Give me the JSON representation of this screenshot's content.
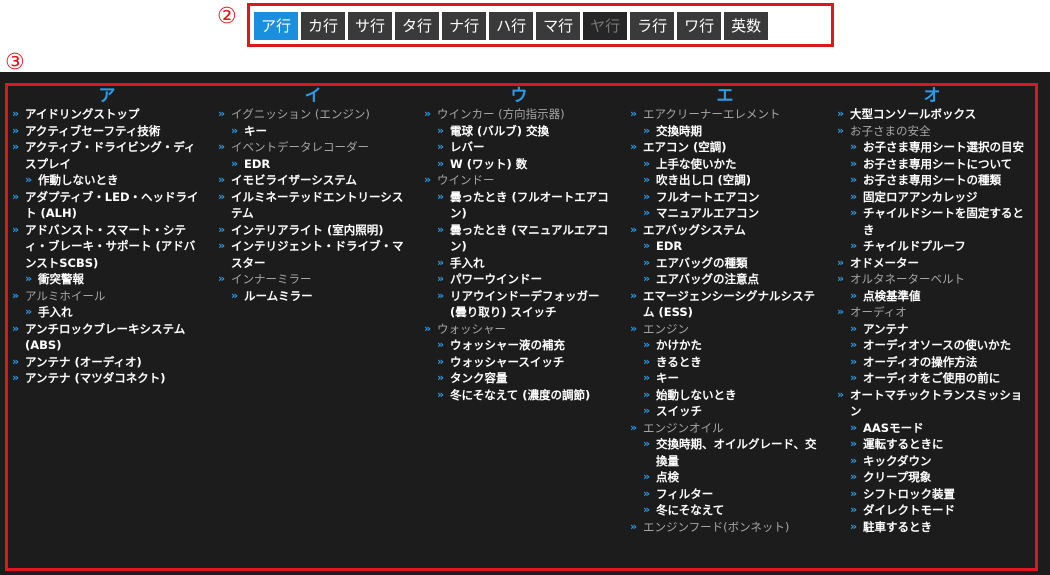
{
  "markers": {
    "tabs": "②",
    "list": "③"
  },
  "tabs": [
    {
      "label": "ア行",
      "state": "active"
    },
    {
      "label": "カ行",
      "state": "normal"
    },
    {
      "label": "サ行",
      "state": "normal"
    },
    {
      "label": "タ行",
      "state": "normal"
    },
    {
      "label": "ナ行",
      "state": "normal"
    },
    {
      "label": "ハ行",
      "state": "normal"
    },
    {
      "label": "マ行",
      "state": "normal"
    },
    {
      "label": "ヤ行",
      "state": "disabled"
    },
    {
      "label": "ラ行",
      "state": "normal"
    },
    {
      "label": "ワ行",
      "state": "normal"
    },
    {
      "label": "英数",
      "state": "normal"
    }
  ],
  "colors": {
    "accent": "#2a9be8",
    "active_tab": "#1a8fdd",
    "frame": "#e0161c",
    "bg": "#1c1c1c"
  },
  "columns": [
    {
      "heading": "ア",
      "items": [
        {
          "text": "アイドリングストップ",
          "level": 0,
          "style": "link"
        },
        {
          "text": "アクティブセーフティ技術",
          "level": 0,
          "style": "link"
        },
        {
          "text": "アクティブ・ドライビング・ディスプレイ",
          "level": 0,
          "style": "link"
        },
        {
          "text": "作動しないとき",
          "level": 1,
          "style": "link"
        },
        {
          "text": "アダプティブ・LED・ヘッドライト (ALH)",
          "level": 0,
          "style": "link"
        },
        {
          "text": "アドバンスト・スマート・シティ・ブレーキ・サポート (アドバンストSCBS)",
          "level": 0,
          "style": "link"
        },
        {
          "text": "衝突警報",
          "level": 1,
          "style": "link"
        },
        {
          "text": "アルミホイール",
          "level": 0,
          "style": "cat"
        },
        {
          "text": "手入れ",
          "level": 1,
          "style": "link"
        },
        {
          "text": "アンチロックブレーキシステム (ABS)",
          "level": 0,
          "style": "link"
        },
        {
          "text": "アンテナ (オーディオ)",
          "level": 0,
          "style": "link"
        },
        {
          "text": "アンテナ (マツダコネクト)",
          "level": 0,
          "style": "link"
        }
      ]
    },
    {
      "heading": "イ",
      "items": [
        {
          "text": "イグニッション (エンジン)",
          "level": 0,
          "style": "cat"
        },
        {
          "text": "キー",
          "level": 1,
          "style": "link"
        },
        {
          "text": "イベントデータレコーダー",
          "level": 0,
          "style": "cat"
        },
        {
          "text": "EDR",
          "level": 1,
          "style": "link"
        },
        {
          "text": "イモビライザーシステム",
          "level": 0,
          "style": "link"
        },
        {
          "text": "イルミネーテッドエントリーシステム",
          "level": 0,
          "style": "link"
        },
        {
          "text": "インテリアライト (室内照明)",
          "level": 0,
          "style": "link"
        },
        {
          "text": "インテリジェント・ドライブ・マスター",
          "level": 0,
          "style": "link"
        },
        {
          "text": "インナーミラー",
          "level": 0,
          "style": "cat"
        },
        {
          "text": "ルームミラー",
          "level": 1,
          "style": "link"
        }
      ]
    },
    {
      "heading": "ウ",
      "items": [
        {
          "text": "ウインカー (方向指示器)",
          "level": 0,
          "style": "cat"
        },
        {
          "text": "電球 (バルブ) 交換",
          "level": 1,
          "style": "link"
        },
        {
          "text": "レバー",
          "level": 1,
          "style": "link"
        },
        {
          "text": "W (ワット) 数",
          "level": 1,
          "style": "link"
        },
        {
          "text": "ウインドー",
          "level": 0,
          "style": "cat"
        },
        {
          "text": "曇ったとき (フルオートエアコン)",
          "level": 1,
          "style": "link"
        },
        {
          "text": "曇ったとき (マニュアルエアコン)",
          "level": 1,
          "style": "link"
        },
        {
          "text": "手入れ",
          "level": 1,
          "style": "link"
        },
        {
          "text": "パワーウインドー",
          "level": 1,
          "style": "link"
        },
        {
          "text": "リアウインドーデフォッガー (曇り取り) スイッチ",
          "level": 1,
          "style": "link"
        },
        {
          "text": "ウォッシャー",
          "level": 0,
          "style": "cat"
        },
        {
          "text": "ウォッシャー液の補充",
          "level": 1,
          "style": "link"
        },
        {
          "text": "ウォッシャースイッチ",
          "level": 1,
          "style": "link"
        },
        {
          "text": "タンク容量",
          "level": 1,
          "style": "link"
        },
        {
          "text": "冬にそなえて (濃度の調節)",
          "level": 1,
          "style": "link"
        }
      ]
    },
    {
      "heading": "エ",
      "items": [
        {
          "text": "エアクリーナーエレメント",
          "level": 0,
          "style": "cat"
        },
        {
          "text": "交換時期",
          "level": 1,
          "style": "link"
        },
        {
          "text": "エアコン (空調)",
          "level": 0,
          "style": "link"
        },
        {
          "text": "上手な使いかた",
          "level": 1,
          "style": "link"
        },
        {
          "text": "吹き出し口 (空調)",
          "level": 1,
          "style": "link"
        },
        {
          "text": "フルオートエアコン",
          "level": 1,
          "style": "link"
        },
        {
          "text": "マニュアルエアコン",
          "level": 1,
          "style": "link"
        },
        {
          "text": "エアバッグシステム",
          "level": 0,
          "style": "link"
        },
        {
          "text": "EDR",
          "level": 1,
          "style": "link"
        },
        {
          "text": "エアバッグの種類",
          "level": 1,
          "style": "link"
        },
        {
          "text": "エアバッグの注意点",
          "level": 1,
          "style": "link"
        },
        {
          "text": "エマージェンシーシグナルシステム (ESS)",
          "level": 0,
          "style": "link"
        },
        {
          "text": "エンジン",
          "level": 0,
          "style": "cat"
        },
        {
          "text": "かけかた",
          "level": 1,
          "style": "link"
        },
        {
          "text": "きるとき",
          "level": 1,
          "style": "link"
        },
        {
          "text": "キー",
          "level": 1,
          "style": "link"
        },
        {
          "text": "始動しないとき",
          "level": 1,
          "style": "link"
        },
        {
          "text": "スイッチ",
          "level": 1,
          "style": "link"
        },
        {
          "text": "エンジンオイル",
          "level": 0,
          "style": "cat"
        },
        {
          "text": "交換時期、オイルグレード、交換量",
          "level": 1,
          "style": "link"
        },
        {
          "text": "点検",
          "level": 1,
          "style": "link"
        },
        {
          "text": "フィルター",
          "level": 1,
          "style": "link"
        },
        {
          "text": "冬にそなえて",
          "level": 1,
          "style": "link"
        },
        {
          "text": "エンジンフード(ボンネット)",
          "level": 0,
          "style": "cat"
        }
      ]
    },
    {
      "heading": "オ",
      "items": [
        {
          "text": "大型コンソールボックス",
          "level": 0,
          "style": "link"
        },
        {
          "text": "お子さまの安全",
          "level": 0,
          "style": "cat"
        },
        {
          "text": "お子さま専用シート選択の目安",
          "level": 1,
          "style": "link"
        },
        {
          "text": "お子さま専用シートについて",
          "level": 1,
          "style": "link"
        },
        {
          "text": "お子さま専用シートの種類",
          "level": 1,
          "style": "link"
        },
        {
          "text": "固定ロアアンカレッジ",
          "level": 1,
          "style": "link"
        },
        {
          "text": "チャイルドシートを固定するとき",
          "level": 1,
          "style": "link"
        },
        {
          "text": "チャイルドプルーフ",
          "level": 1,
          "style": "link"
        },
        {
          "text": "オドメーター",
          "level": 0,
          "style": "link"
        },
        {
          "text": "オルタネーターベルト",
          "level": 0,
          "style": "cat"
        },
        {
          "text": "点検基準値",
          "level": 1,
          "style": "link"
        },
        {
          "text": "オーディオ",
          "level": 0,
          "style": "cat"
        },
        {
          "text": "アンテナ",
          "level": 1,
          "style": "link"
        },
        {
          "text": "オーディオソースの使いかた",
          "level": 1,
          "style": "link"
        },
        {
          "text": "オーディオの操作方法",
          "level": 1,
          "style": "link"
        },
        {
          "text": "オーディオをご使用の前に",
          "level": 1,
          "style": "link"
        },
        {
          "text": "オートマチックトランスミッション",
          "level": 0,
          "style": "link"
        },
        {
          "text": "AASモード",
          "level": 1,
          "style": "link"
        },
        {
          "text": "運転するときに",
          "level": 1,
          "style": "link"
        },
        {
          "text": "キックダウン",
          "level": 1,
          "style": "link"
        },
        {
          "text": "クリープ現象",
          "level": 1,
          "style": "link"
        },
        {
          "text": "シフトロック装置",
          "level": 1,
          "style": "link"
        },
        {
          "text": "ダイレクトモード",
          "level": 1,
          "style": "link"
        },
        {
          "text": "駐車するとき",
          "level": 1,
          "style": "link"
        }
      ]
    }
  ]
}
